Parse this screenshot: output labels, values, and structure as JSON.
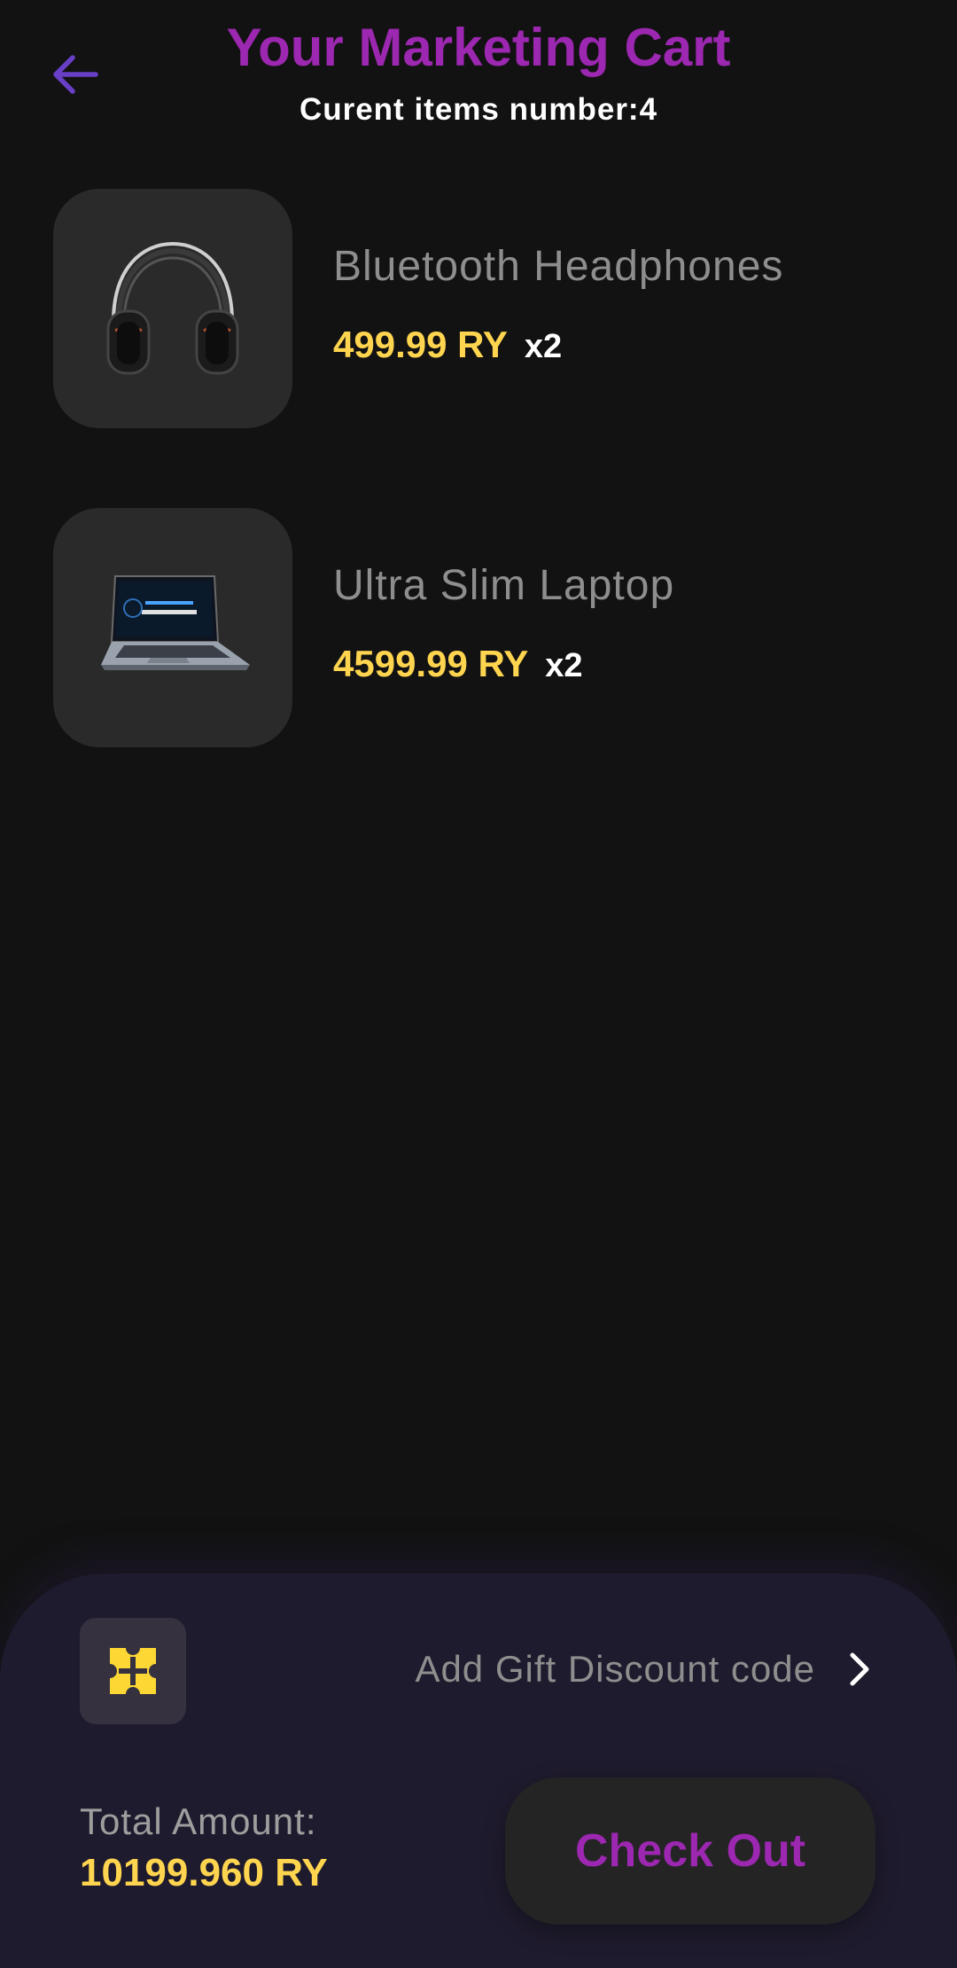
{
  "header": {
    "title": "Your Marketing Cart",
    "subtitle": "Curent items number:4",
    "back_icon": "arrow-left-icon"
  },
  "cart": {
    "items": [
      {
        "name": "Bluetooth Headphones",
        "price": "499.99 RY",
        "quantity": "x2",
        "image": "headphones-image"
      },
      {
        "name": "Ultra Slim Laptop",
        "price": "4599.99 RY",
        "quantity": "x2",
        "image": "laptop-image"
      }
    ]
  },
  "footer": {
    "gift_icon": "gift-ticket-icon",
    "gift_label": "Add Gift Discount code",
    "gift_chevron_icon": "chevron-right-icon",
    "total_label": "Total Amount:",
    "total_value": "10199.960 RY",
    "checkout_label": "Check Out"
  },
  "colors": {
    "background": "#121212",
    "accent_purple": "#9c27b0",
    "price_yellow": "#ffd54f",
    "sheet_bg": "#1f1b2e",
    "card_bg": "#2a2a2a"
  }
}
